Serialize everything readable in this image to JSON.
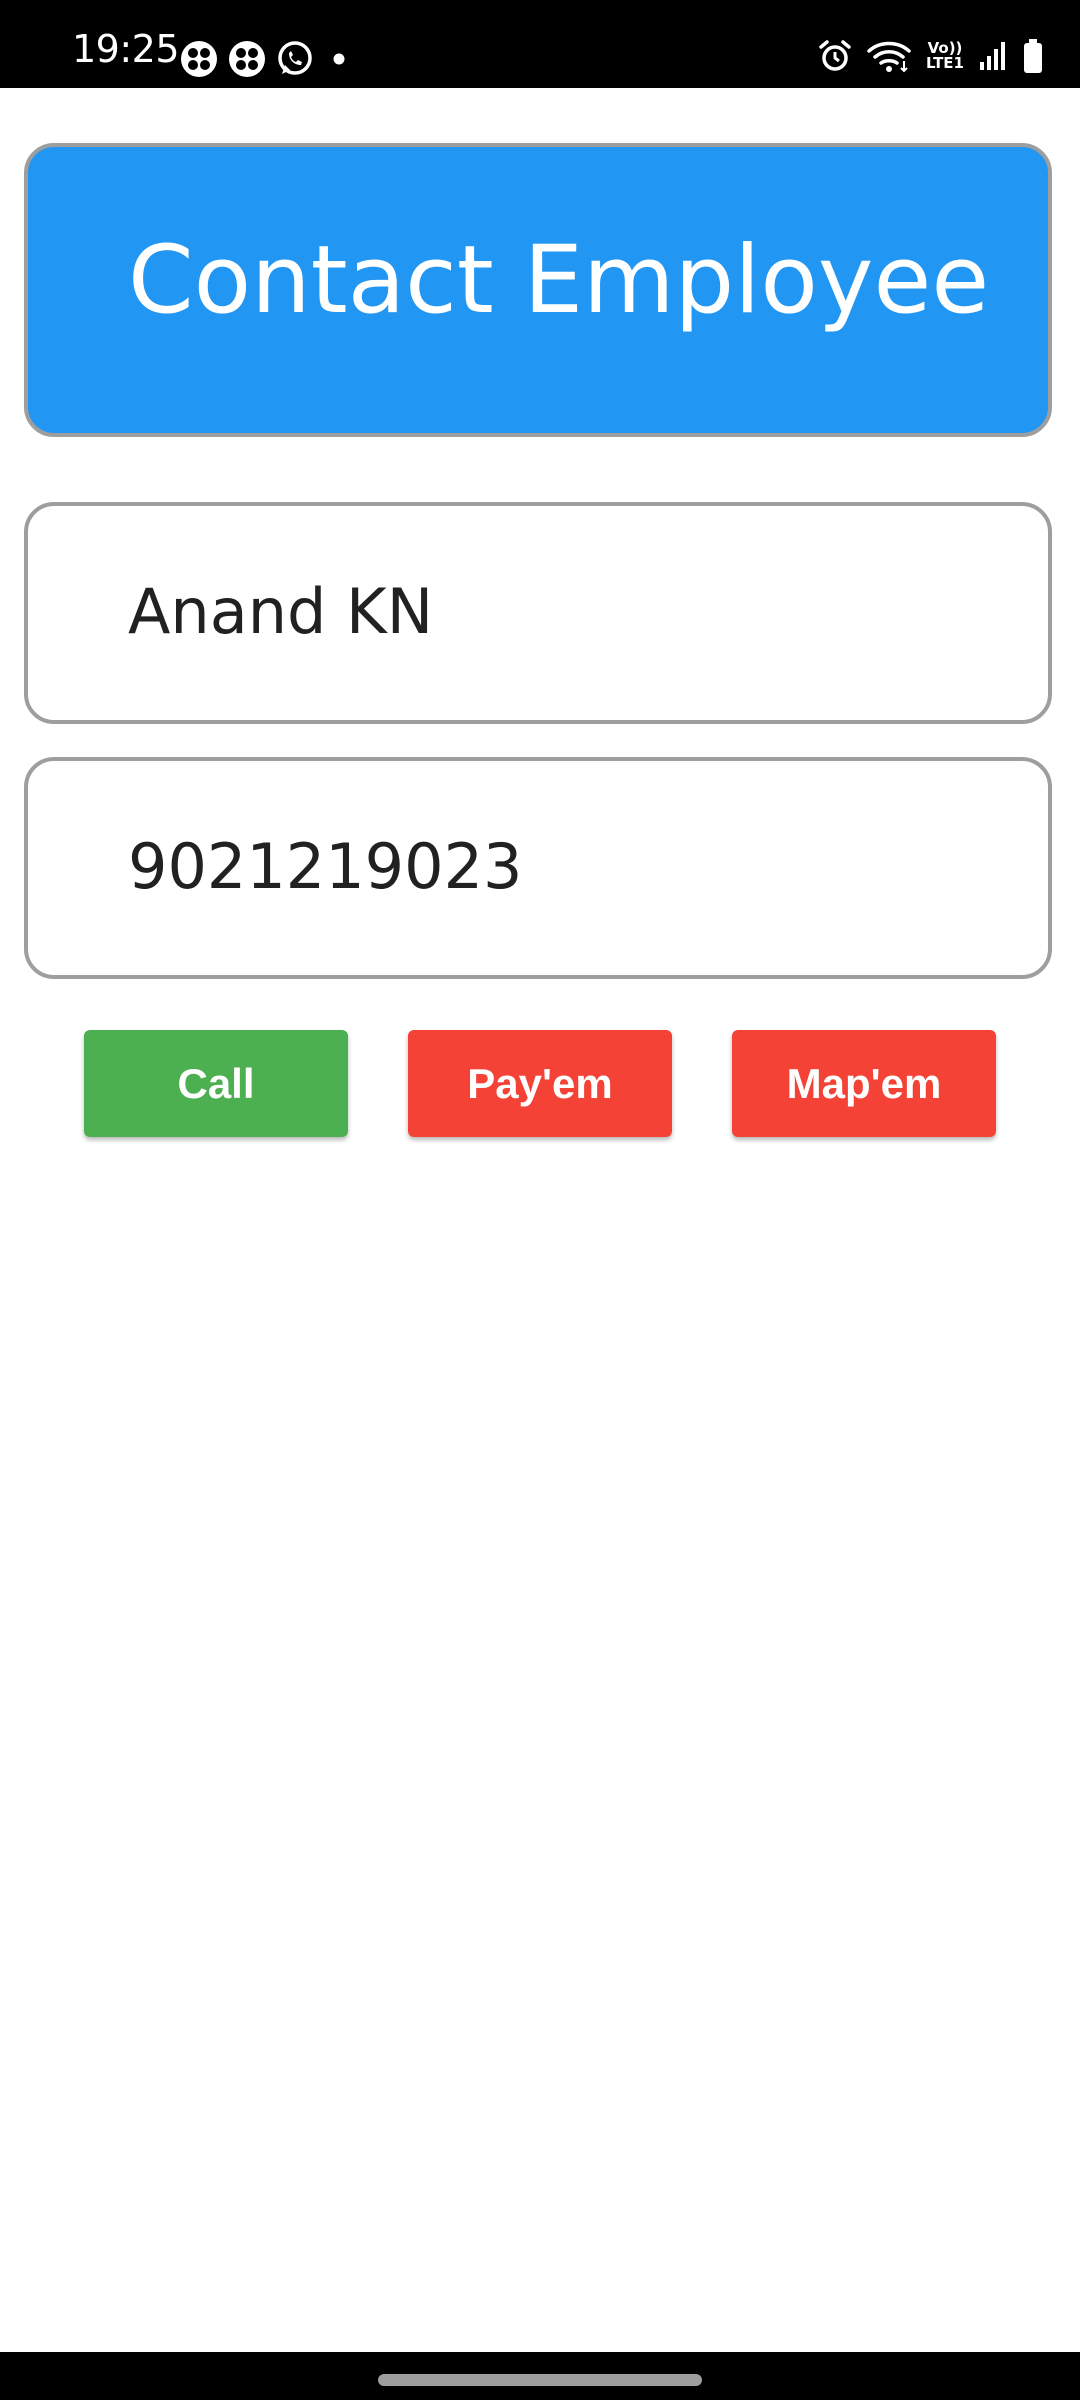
{
  "status_bar": {
    "time": "19:25",
    "left_icons": [
      "clover-app-icon",
      "clover-app-icon",
      "whatsapp-icon",
      "notification-dot-icon"
    ],
    "right_icons": [
      "alarm-icon",
      "wifi-icon",
      "volte-icon",
      "signal-icon",
      "battery-icon"
    ],
    "volte_top": "Vo))",
    "volte_bottom": "LTE1"
  },
  "header": {
    "title": "Contact Employee",
    "background_color": "#2196f3"
  },
  "employee": {
    "name": "Anand KN",
    "phone": "9021219023"
  },
  "actions": {
    "call_label": "Call",
    "call_color": "#4caf50",
    "pay_label": "Pay'em",
    "pay_color": "#f44336",
    "map_label": "Map'em",
    "map_color": "#f44336"
  }
}
